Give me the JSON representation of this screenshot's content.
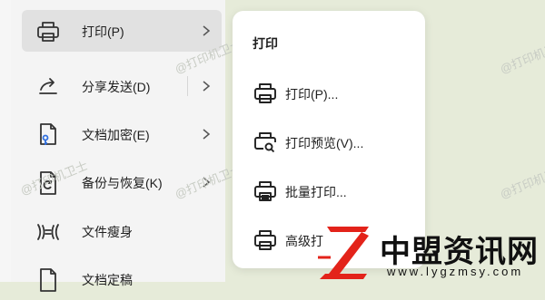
{
  "menu": {
    "items": [
      {
        "label": "打印(P)",
        "icon": "printer-icon"
      },
      {
        "label": "分享发送(D)",
        "icon": "share-icon"
      },
      {
        "label": "文档加密(E)",
        "icon": "document-key-icon"
      },
      {
        "label": "备份与恢复(K)",
        "icon": "backup-icon"
      },
      {
        "label": "文件瘦身",
        "icon": "compress-icon"
      },
      {
        "label": "文档定稿",
        "icon": "document-final-icon"
      }
    ]
  },
  "submenu": {
    "title": "打印",
    "items": [
      {
        "label": "打印(P)...",
        "icon": "printer-icon"
      },
      {
        "label": "打印预览(V)...",
        "icon": "print-preview-icon"
      },
      {
        "label": "批量打印...",
        "icon": "batch-print-icon"
      },
      {
        "label": "高级打",
        "icon": "advanced-print-icon"
      }
    ]
  },
  "watermark": {
    "text": "@打印机卫士"
  },
  "brand": {
    "name": "中盟资讯网",
    "url": "www.lygzmsy.com",
    "logo_letter": "Z",
    "accent_color": "#e3231a"
  }
}
